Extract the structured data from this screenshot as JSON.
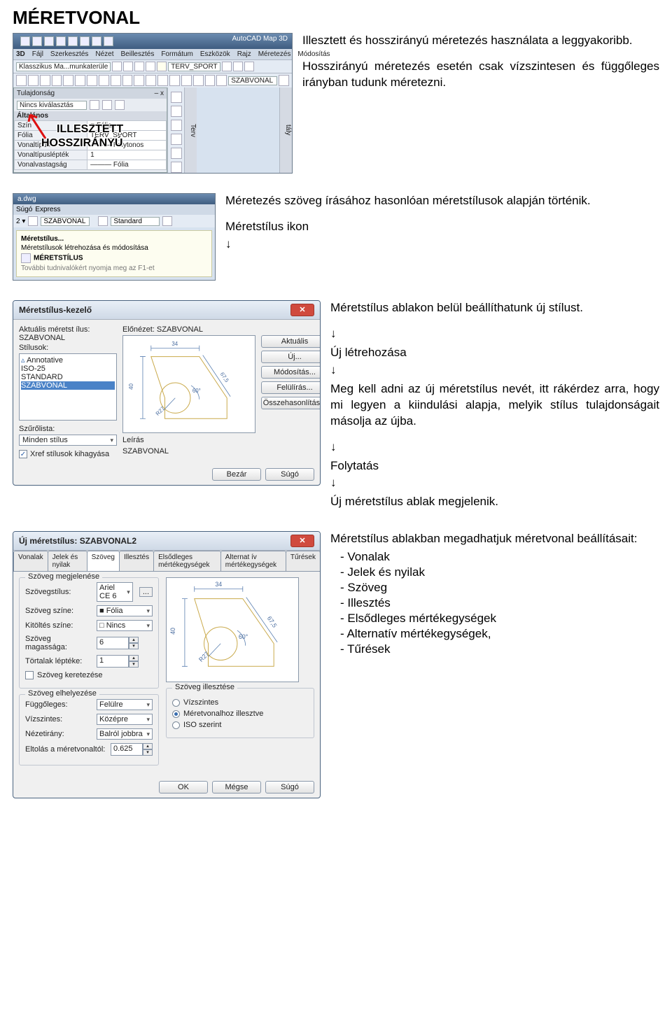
{
  "page": {
    "title": "MÉRETVONAL",
    "para1a": "Illesztett és hosszirányú méretezés használata a leggyakoribb.",
    "para1b": "Hosszirányú méretezés esetén csak vízszintesen és függőleges irányban tudunk méretezni.",
    "para2a": "Méretezés szöveg írásához hasonlóan méretstílusok alapján történik.",
    "para2b": "Méretstílus ikon",
    "para3a": "Méretstílus ablakon belül beállíthatunk új stílust.",
    "para3b": "Új létrehozása",
    "para3c": "Meg kell adni az új méretstílus nevét, itt rákérdez arra, hogy mi legyen a kiindulási alapja, melyik stílus tulajdonságait másolja az újba.",
    "para3d": "Folytatás",
    "para3e": "Új méretstílus ablak megjelenik.",
    "para4a": "Méretstílus ablakban megadhatjuk méretvonal beállításait:",
    "list4": [
      "Vonalak",
      "Jelek és nyilak",
      "Szöveg",
      "Illesztés",
      "Elsődleges mértékegységek",
      "Alternatív mértékegységek,",
      "Tűrések"
    ],
    "arrow": "↓"
  },
  "ribbon": {
    "app_title": "AutoCAD Map 3D",
    "tab_3d": "3D",
    "menus": [
      "Fájl",
      "Szerkesztés",
      "Nézet",
      "Beillesztés",
      "Formátum",
      "Eszközök",
      "Rajz",
      "Méretezés",
      "Módosítás"
    ],
    "workspace": "Klasszikus Ma...munkaterüle",
    "layer_name": "TERV_SPORT",
    "dim_style": "SZABVONAL",
    "props_title": "Tulajdonság",
    "props_sub": "Nincs kiválasztás",
    "props_group": "Általános",
    "props_rows": [
      [
        "Szín",
        "■ Fólia"
      ],
      [
        "Fólia",
        "TERV_SPORT"
      ],
      [
        "Vonaltípus",
        "——— Folytonos"
      ],
      [
        "Vonaltípuslépték",
        "1"
      ],
      [
        "Vonalvastagság",
        "——— Fólia"
      ]
    ],
    "sidetab": "Terv",
    "sidetab2": "tály",
    "annot_illesztett": "ILLESZTETT",
    "annot_hossziranyu": "HOSSZIRÁNYÚ",
    "panel_close": "– x"
  },
  "tooltip": {
    "title_left": "a.dwg",
    "menu_sugo": "Súgó",
    "menu_express": "Express",
    "sel1": "SZABVONAL",
    "sel2": "Standard",
    "line1": "Méretstílus...",
    "line2": "Méretstílusok létrehozása és módosítása",
    "line3": "MÉRETSTÍLUS",
    "line4": "További tudnivalókért nyomja meg az F1-et"
  },
  "dlg_msk": {
    "title": "Méretstílus-kezelő",
    "lbl_current": "Aktuális méretst ílus: SZABVONAL",
    "lbl_styles": "Stílusok:",
    "styles": [
      "Annotative",
      "ISO-25",
      "STANDARD",
      "SZABVONAL"
    ],
    "lbl_preview": "Előnézet: SZABVONAL",
    "lbl_filter": "Szűrőlista:",
    "filter_val": "Minden stílus",
    "chk_xref": "Xref stílusok kihagyása",
    "lbl_desc": "Leírás",
    "desc_val": "SZABVONAL",
    "btn_set": "Aktuális",
    "btn_new": "Új...",
    "btn_mod": "Módosítás...",
    "btn_over": "Felülírás...",
    "btn_cmp": "Összehasonlítás...",
    "btn_close": "Bezár",
    "btn_help": "Súgó",
    "preview_dims": {
      "top": "34",
      "left": "40",
      "diag": "67,5",
      "ang": "60°",
      "rad": "R27"
    }
  },
  "dlg_ums": {
    "title": "Új méretstílus: SZABVONAL2",
    "tabs": [
      "Vonalak",
      "Jelek és nyilak",
      "Szöveg",
      "Illesztés",
      "Elsődleges mértékegységek",
      "Alternat ív mértékegységek",
      "Tűrések"
    ],
    "active_tab": 2,
    "grp_appear": "Szöveg megjelenése",
    "fld_style": "Szövegstílus:",
    "val_style": "Ariel CE 6",
    "fld_color": "Szöveg színe:",
    "val_color": "■ Fólia",
    "fld_fill": "Kitöltés színe:",
    "val_fill": "□ Nincs",
    "fld_height": "Szöveg magassága:",
    "val_height": "6",
    "fld_frac": "Törtalak léptéke:",
    "val_frac": "1",
    "chk_frame": "Szöveg keretezése",
    "grp_place": "Szöveg elhelyezése",
    "fld_vert": "Függőleges:",
    "val_vert": "Felülre",
    "fld_horz": "Vízszintes:",
    "val_horz": "Középre",
    "fld_view": "Nézetirány:",
    "val_view": "Balról jobbra",
    "fld_offset": "Eltolás a méretvonaltól:",
    "val_offset": "0.625",
    "grp_align": "Szöveg illesztése",
    "rad_horiz": "Vízszintes",
    "rad_dim": "Méretvonalhoz illesztve",
    "rad_iso": "ISO szerint",
    "btn_ok": "OK",
    "btn_cancel": "Mégse",
    "btn_help": "Súgó",
    "preview_dims": {
      "top": "34",
      "left": "40",
      "diag": "67,5",
      "ang": "60°",
      "rad": "R27"
    }
  }
}
